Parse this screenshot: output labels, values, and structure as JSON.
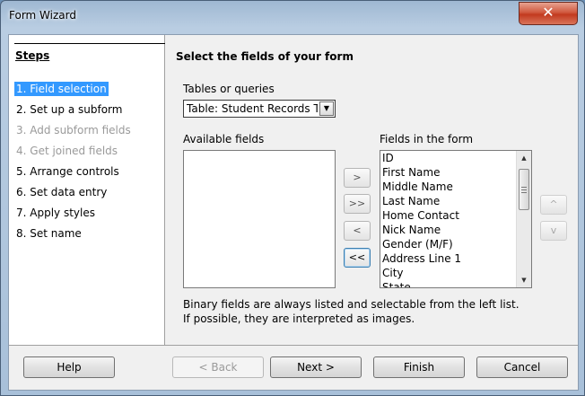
{
  "window": {
    "title": "Form Wizard",
    "close_label": "✕"
  },
  "steps": {
    "title": "Steps",
    "items": [
      {
        "label": "1. Field selection",
        "state": "active"
      },
      {
        "label": "2. Set up a subform",
        "state": "normal"
      },
      {
        "label": "3. Add subform fields",
        "state": "disabled"
      },
      {
        "label": "4. Get joined fields",
        "state": "disabled"
      },
      {
        "label": "5. Arrange controls",
        "state": "normal"
      },
      {
        "label": "6. Set data entry",
        "state": "normal"
      },
      {
        "label": "7. Apply styles",
        "state": "normal"
      },
      {
        "label": "8. Set name",
        "state": "normal"
      }
    ]
  },
  "main": {
    "heading": "Select the fields of your form",
    "tables_label": "Tables or queries",
    "table_selected": "Table: Student Records Template",
    "available_label": "Available fields",
    "available_fields": [],
    "form_fields_label": "Fields in the form",
    "form_fields": [
      "ID",
      "First Name",
      "Middle Name",
      "Last Name",
      "Home Contact",
      "Nick Name",
      "Gender (M/F)",
      "Address Line 1",
      "City",
      "State"
    ],
    "move_buttons": [
      ">",
      ">>",
      "<",
      "<<"
    ],
    "order_buttons": [
      "^",
      "v"
    ],
    "info_line1": "Binary fields are always listed and selectable from the left list.",
    "info_line2": "If possible, they are interpreted as images."
  },
  "footer": {
    "help": "Help",
    "back": "< Back",
    "next": "Next >",
    "finish": "Finish",
    "cancel": "Cancel"
  }
}
